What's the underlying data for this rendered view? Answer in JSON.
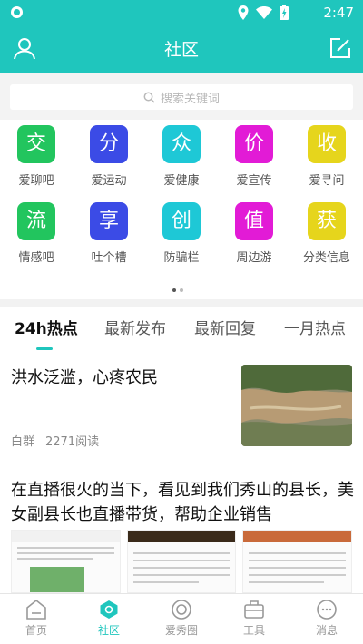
{
  "status": {
    "time": "2:47"
  },
  "appbar": {
    "title": "社区"
  },
  "search": {
    "placeholder": "搜索关键词"
  },
  "grid": [
    {
      "char": "交",
      "label": "爱聊吧",
      "color": "#22c55e"
    },
    {
      "char": "分",
      "label": "爱运动",
      "color": "#3b4be6"
    },
    {
      "char": "众",
      "label": "爱健康",
      "color": "#1ec8d6"
    },
    {
      "char": "价",
      "label": "爱宣传",
      "color": "#e21bd6"
    },
    {
      "char": "收",
      "label": "爱寻问",
      "color": "#e6d51c"
    },
    {
      "char": "流",
      "label": "情感吧",
      "color": "#22c55e"
    },
    {
      "char": "享",
      "label": "吐个槽",
      "color": "#3b4be6"
    },
    {
      "char": "创",
      "label": "防骗栏",
      "color": "#1ec8d6"
    },
    {
      "char": "值",
      "label": "周边游",
      "color": "#e21bd6"
    },
    {
      "char": "获",
      "label": "分类信息",
      "color": "#e6d51c"
    }
  ],
  "tabs": [
    "24h热点",
    "最新发布",
    "最新回复",
    "一月热点"
  ],
  "articles": [
    {
      "title": "洪水泛滥，心疼农民",
      "author": "白群",
      "reads": "2271阅读"
    },
    {
      "title": "在直播很火的当下，看见到我们秀山的县长，美女副县长也直播带货，帮助企业销售"
    }
  ],
  "nav": [
    "首页",
    "社区",
    "爱秀圈",
    "工具",
    "消息"
  ],
  "colors": {
    "accent": "#1fc6bd"
  }
}
